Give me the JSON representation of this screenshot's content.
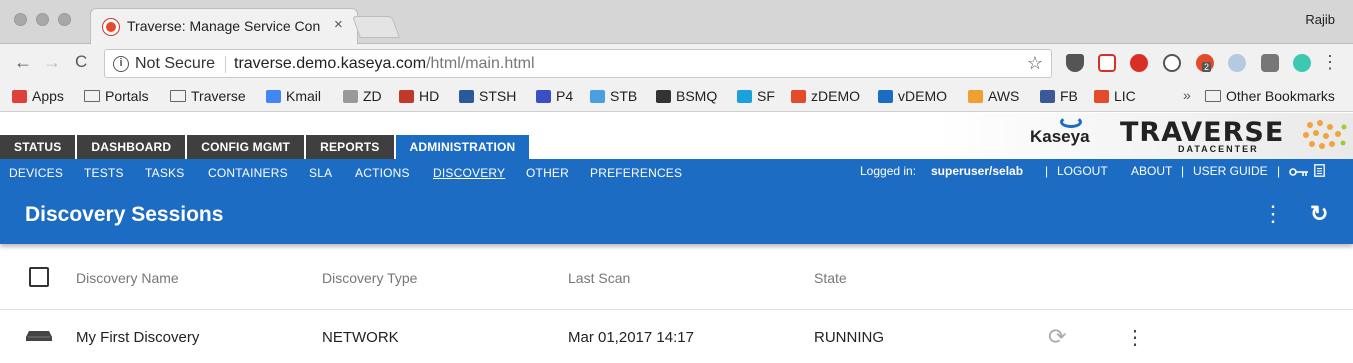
{
  "browser": {
    "tab_title": "Traverse: Manage Service Con",
    "tab_close": "×",
    "profile_name": "Rajib",
    "security_label": "Not Secure",
    "url_host": "traverse.demo.kaseya.com",
    "url_path": "/html/main.html",
    "star": "☆",
    "menu": "⋮",
    "back": "←",
    "forward": "→",
    "reload": "C",
    "ext_badge": "2"
  },
  "bookmarks": [
    {
      "label": "Apps",
      "icon": "apps-icon",
      "color": "#e0403a"
    },
    {
      "label": "Portals",
      "icon": "folder-icon",
      "color": "#666"
    },
    {
      "label": "Traverse",
      "icon": "folder-icon",
      "color": "#666"
    },
    {
      "label": "Kmail",
      "icon": "google-icon",
      "color": "#4285f4"
    },
    {
      "label": "ZD",
      "icon": "gear-icon",
      "color": "#999"
    },
    {
      "label": "HD",
      "icon": "hd-icon",
      "color": "#c0392b"
    },
    {
      "label": "STSH",
      "icon": "stsh-icon",
      "color": "#2a5a9a"
    },
    {
      "label": "P4",
      "icon": "p4-icon",
      "color": "#3b4fc4"
    },
    {
      "label": "STB",
      "icon": "stb-icon",
      "color": "#4a9fe0"
    },
    {
      "label": "BSMQ",
      "icon": "smiley-icon",
      "color": "#333"
    },
    {
      "label": "SF",
      "icon": "cloud-icon",
      "color": "#1aa0db"
    },
    {
      "label": "zDEMO",
      "icon": "traverse-icon",
      "color": "#e34b2c"
    },
    {
      "label": "vDEMO",
      "icon": "kaseya-icon",
      "color": "#1d6cc4"
    },
    {
      "label": "AWS",
      "icon": "aws-icon",
      "color": "#f0a030"
    },
    {
      "label": "FB",
      "icon": "facebook-icon",
      "color": "#3b5998"
    },
    {
      "label": "LIC",
      "icon": "traverse-icon",
      "color": "#e34b2c"
    }
  ],
  "bookmarks_overflow": "»",
  "other_bookmarks": "Other Bookmarks",
  "app": {
    "main_tabs": [
      "STATUS",
      "DASHBOARD",
      "CONFIG MGMT",
      "REPORTS",
      "ADMINISTRATION"
    ],
    "active_main_tab": "ADMINISTRATION",
    "sub_tabs": [
      "DEVICES",
      "TESTS",
      "TASKS",
      "CONTAINERS",
      "SLA",
      "ACTIONS",
      "DISCOVERY",
      "OTHER",
      "PREFERENCES"
    ],
    "active_sub_tab": "DISCOVERY",
    "logged_in_label": "Logged in:",
    "user": "superuser/selab",
    "sep1": "|",
    "logout": "LOGOUT",
    "about": "ABOUT",
    "sep2": "|",
    "user_guide": "USER GUIDE",
    "sep3": "|",
    "brand_kaseya": "Kaseya",
    "brand_traverse": "TRAVERSE",
    "brand_datacenter": "DATACENTER",
    "brand_color": "#1d6cc4"
  },
  "page": {
    "title": "Discovery Sessions",
    "more_icon": "⋮",
    "refresh_icon": "↻"
  },
  "table": {
    "columns": [
      "Discovery Name",
      "Discovery Type",
      "Last Scan",
      "State"
    ],
    "rows": [
      {
        "name": "My First Discovery",
        "type": "NETWORK",
        "last_scan": "Mar 01,2017 14:17",
        "state": "RUNNING"
      }
    ]
  },
  "row_actions": {
    "sync_icon": "⟳",
    "more_icon": "⋮"
  }
}
